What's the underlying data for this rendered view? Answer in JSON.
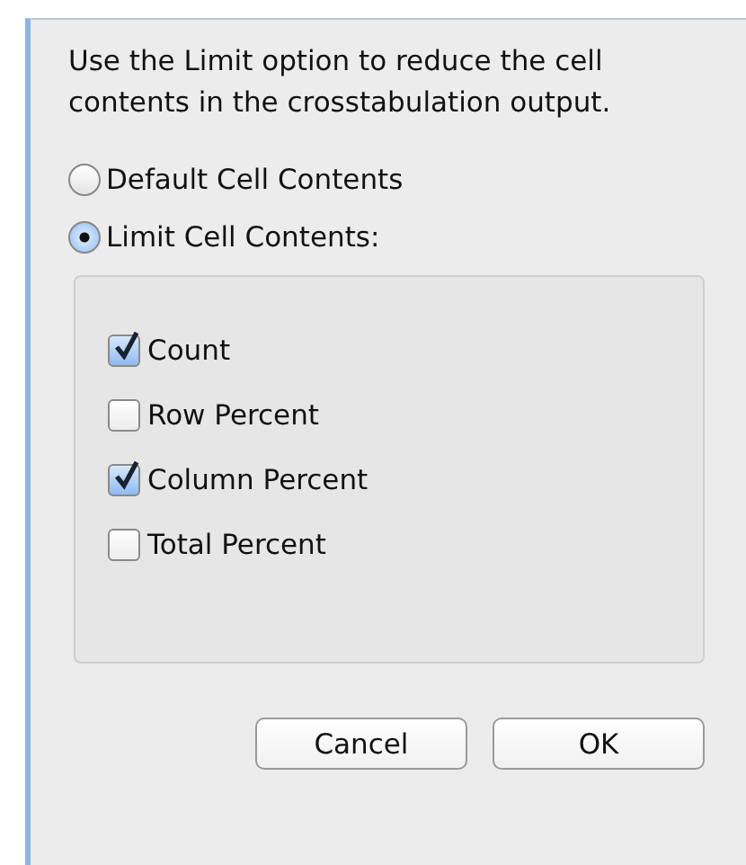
{
  "description": "Use the Limit option to reduce the cell contents in the crosstabulation output.",
  "options": [
    {
      "label": "Default Cell Contents",
      "selected": false
    },
    {
      "label": "Limit Cell Contents:",
      "selected": true
    }
  ],
  "contents": [
    {
      "label": "Count",
      "checked": true
    },
    {
      "label": "Row Percent",
      "checked": false
    },
    {
      "label": "Column Percent",
      "checked": true
    },
    {
      "label": "Total Percent",
      "checked": false
    }
  ],
  "buttons": [
    "Cancel",
    "OK"
  ]
}
